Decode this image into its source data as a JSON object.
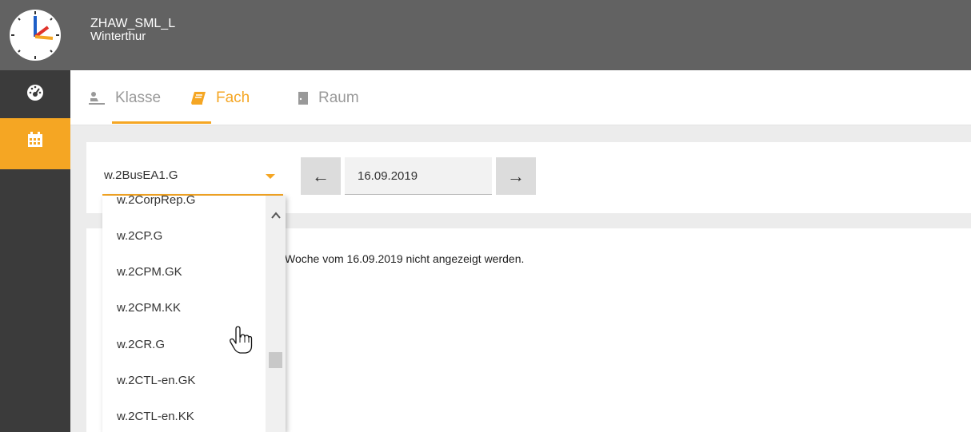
{
  "header": {
    "school_name": "ZHAW_SML_L",
    "location": "Winterthur"
  },
  "sidebar": {
    "items": [
      {
        "icon": "dashboard-icon",
        "active": false
      },
      {
        "icon": "calendar-icon",
        "active": true
      }
    ]
  },
  "tabs": [
    {
      "label": "Klasse",
      "icon": "student-desk-icon",
      "active": false
    },
    {
      "label": "Fach",
      "icon": "book-icon",
      "active": true
    },
    {
      "label": "Raum",
      "icon": "door-icon",
      "active": false
    }
  ],
  "toolbar": {
    "selected_subject": "w.2BusEA1.G",
    "date": "16.09.2019",
    "prev_label": "←",
    "next_label": "→"
  },
  "content": {
    "message": "Woche vom 16.09.2019 nicht angezeigt werden."
  },
  "dropdown": {
    "options": [
      "w.2CorpRep.G",
      "w.2CP.G",
      "w.2CPM.GK",
      "w.2CPM.KK",
      "w.2CR.G",
      "w.2CTL-en.GK",
      "w.2CTL-en.KK"
    ]
  },
  "colors": {
    "accent": "#f5a623",
    "header_bg": "#626262",
    "sidebar_bg": "#3b3b3b"
  }
}
